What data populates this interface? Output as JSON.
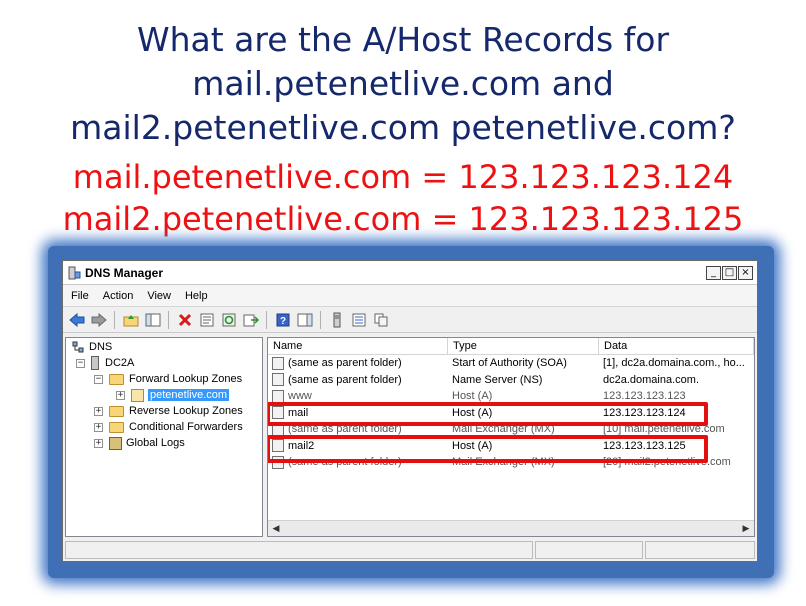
{
  "slide": {
    "question_lines": [
      "What are the A/Host Records for",
      "mail.petenetlive.com and",
      "mail2.petenetlive.com petenetlive.com?"
    ],
    "answer_lines": [
      "mail.petenetlive.com = 123.123.123.124",
      "mail2.petenetlive.com = 123.123.123.125"
    ],
    "question_color": "#14286b",
    "answer_color": "#ee1111"
  },
  "window": {
    "title": "DNS Manager",
    "controls": {
      "minimize": "_",
      "maximize": "□",
      "close": "×"
    }
  },
  "menu": [
    "File",
    "Action",
    "View",
    "Help"
  ],
  "toolbar_icons": [
    "back-icon",
    "forward-icon",
    "up-folder-icon",
    "show-hide-tree-icon",
    "delete-icon",
    "properties-icon",
    "refresh-icon",
    "export-icon",
    "help-icon",
    "show-pane-icon",
    "server-icon",
    "list-icon",
    "copy-icon"
  ],
  "tree": {
    "root": "DNS",
    "server": "DC2A",
    "forward_zones": "Forward Lookup Zones",
    "selected_zone": "petenetlive.com",
    "reverse_zones": "Reverse Lookup Zones",
    "conditional_forwarders": "Conditional Forwarders",
    "global_logs": "Global Logs"
  },
  "records": {
    "columns": [
      "Name",
      "Type",
      "Data"
    ],
    "rows": [
      {
        "name": "(same as parent folder)",
        "type": "Start of Authority (SOA)",
        "data": "[1], dc2a.domaina.com., ho..."
      },
      {
        "name": "(same as parent folder)",
        "type": "Name Server (NS)",
        "data": "dc2a.domaina.com."
      },
      {
        "name": "www",
        "type": "Host (A)",
        "data": "123.123.123.123"
      },
      {
        "name": "mail",
        "type": "Host (A)",
        "data": "123.123.123.124"
      },
      {
        "name": "(same as parent folder)",
        "type": "Mail Exchanger (MX)",
        "data": "[10] mail.petenetlive.com"
      },
      {
        "name": "mail2",
        "type": "Host (A)",
        "data": "123.123.123.125"
      },
      {
        "name": "(same as parent folder)",
        "type": "Mail Exchanger (MX)",
        "data": "[20] mail2.petenetlive.com"
      }
    ]
  },
  "accent": {
    "highlight": "#e40f0f",
    "selection": "#3399ff",
    "glow": "#3d73c6"
  }
}
